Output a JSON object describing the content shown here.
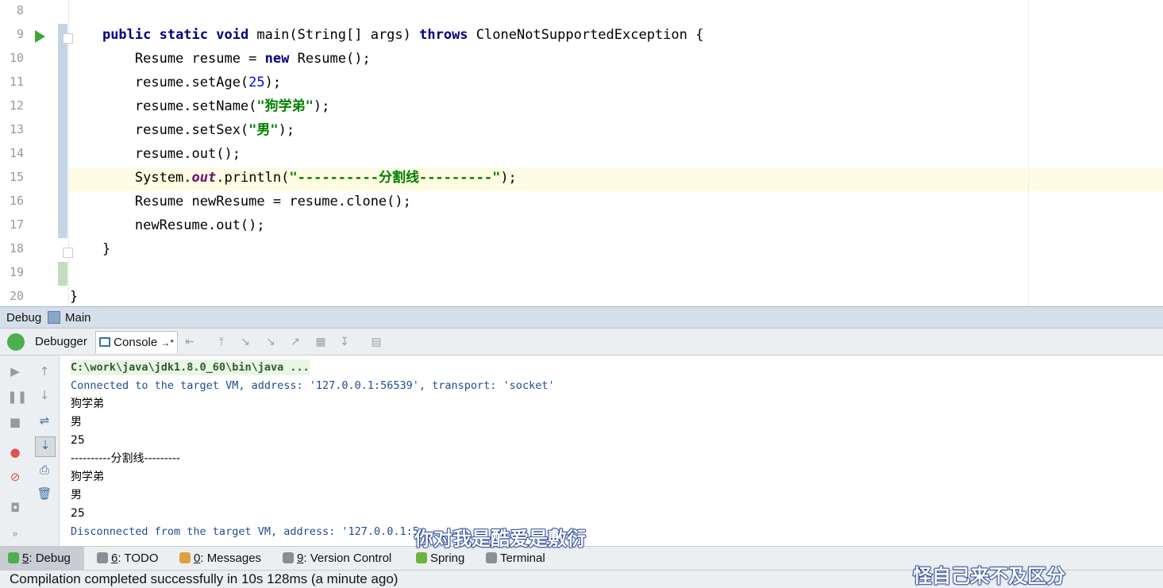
{
  "editor": {
    "line_numbers": [
      "8",
      "9",
      "10",
      "11",
      "12",
      "13",
      "14",
      "15",
      "16",
      "17",
      "18",
      "19",
      "20"
    ],
    "lines": [
      {
        "tokens": []
      },
      {
        "tokens": [
          {
            "t": "    "
          },
          {
            "t": "public static void",
            "c": "kw"
          },
          {
            "t": " main(String[] args) "
          },
          {
            "t": "throws",
            "c": "kw"
          },
          {
            "t": " CloneNotSupportedException {"
          }
        ]
      },
      {
        "tokens": [
          {
            "t": "        Resume resume = "
          },
          {
            "t": "new",
            "c": "kw"
          },
          {
            "t": " Resume();"
          }
        ]
      },
      {
        "tokens": [
          {
            "t": "        resume.setAge("
          },
          {
            "t": "25",
            "c": "num"
          },
          {
            "t": ");"
          }
        ]
      },
      {
        "tokens": [
          {
            "t": "        resume.setName("
          },
          {
            "t": "\"狗学弟\"",
            "c": "str"
          },
          {
            "t": ");"
          }
        ]
      },
      {
        "tokens": [
          {
            "t": "        resume.setSex("
          },
          {
            "t": "\"男\"",
            "c": "str"
          },
          {
            "t": ");"
          }
        ]
      },
      {
        "tokens": [
          {
            "t": "        resume.out();"
          }
        ]
      },
      {
        "tokens": [
          {
            "t": "        System."
          },
          {
            "t": "out",
            "c": "field"
          },
          {
            "t": ".println("
          },
          {
            "t": "\"----------分割线---------\"",
            "c": "str"
          },
          {
            "t": ");"
          }
        ]
      },
      {
        "tokens": [
          {
            "t": "        Resume newResume = resume.clone();"
          }
        ]
      },
      {
        "tokens": [
          {
            "t": "        newResume.out();"
          }
        ]
      },
      {
        "tokens": [
          {
            "t": "    }"
          }
        ]
      },
      {
        "tokens": []
      },
      {
        "tokens": [
          {
            "t": "}"
          }
        ]
      }
    ]
  },
  "debug_panel": {
    "title": "Debug",
    "config": "Main",
    "tabs": {
      "debugger": "Debugger",
      "console": "Console",
      "console_suffix": "→*"
    }
  },
  "console_output": [
    {
      "text": "C:\\work\\java\\jdk1.8.0_60\\bin\\java ...",
      "kind": "cmd"
    },
    {
      "text": "Connected to the target VM, address: '127.0.0.1:56539', transport: 'socket'",
      "kind": "sys"
    },
    {
      "text": "狗学弟",
      "kind": "out"
    },
    {
      "text": "男",
      "kind": "out"
    },
    {
      "text": "25",
      "kind": "out"
    },
    {
      "text": "----------分割线---------",
      "kind": "out"
    },
    {
      "text": "狗学弟",
      "kind": "out"
    },
    {
      "text": "男",
      "kind": "out"
    },
    {
      "text": "25",
      "kind": "out"
    },
    {
      "text": "Disconnected from the target VM, address: '127.0.0.1:5",
      "kind": "sys"
    }
  ],
  "bottom_tabs": [
    {
      "key": "5",
      "label": "Debug",
      "icon": "bug-icon",
      "active": true
    },
    {
      "key": "6",
      "label": "TODO",
      "icon": "todo-icon"
    },
    {
      "key": "0",
      "label": "Messages",
      "icon": "messages-icon"
    },
    {
      "key": "9",
      "label": "Version Control",
      "icon": "version-control-icon"
    },
    {
      "key": "",
      "label": "Spring",
      "icon": "spring-leaf-icon"
    },
    {
      "key": "",
      "label": "Terminal",
      "icon": "terminal-icon"
    }
  ],
  "status": {
    "text": "Compilation completed successfully in 10s 128ms (a minute ago)"
  },
  "subtitles": {
    "line1": "你对我是酷爱是敷衍",
    "line2": "怪自己来不及区分"
  },
  "colors": {
    "keyword": "#000080",
    "string": "#008000",
    "number": "#0000ff",
    "field": "#660e7a",
    "run": "#3aa63a"
  }
}
